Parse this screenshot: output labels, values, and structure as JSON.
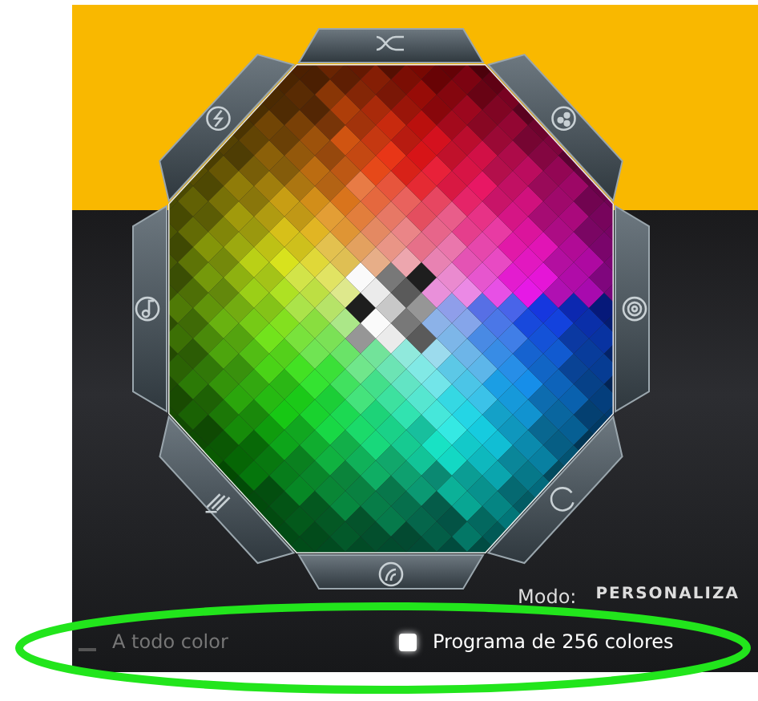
{
  "mode": {
    "label": "Modo:",
    "value": "PERSONALIZA"
  },
  "options": [
    {
      "kind": "toggle",
      "label": "A todo color",
      "disabled": true
    },
    {
      "kind": "checkbox",
      "label": "Programa de 256 colores",
      "checked": false
    }
  ]
}
